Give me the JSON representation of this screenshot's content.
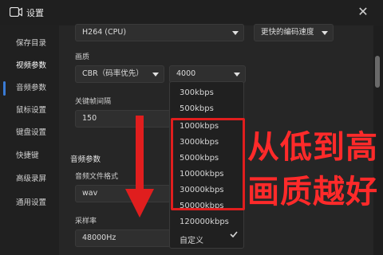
{
  "window": {
    "title": "设置",
    "close_symbol": "✕"
  },
  "sidebar": {
    "items": [
      {
        "label": "保存目录"
      },
      {
        "label": "视频参数"
      },
      {
        "label": "音频参数"
      },
      {
        "label": "鼠标设置"
      },
      {
        "label": "键盘设置"
      },
      {
        "label": "快捷键"
      },
      {
        "label": "高级录屏"
      },
      {
        "label": "通用设置"
      }
    ],
    "active_item": "视频参数"
  },
  "video": {
    "encoder_value": "H264 (CPU)",
    "speed_value": "更快的编码速度",
    "quality_label": "画质",
    "quality_mode_value": "CBR（码率优先）",
    "bitrate_value": "4000",
    "keyframe_label": "关键帧间隔",
    "keyframe_value": "150"
  },
  "audio": {
    "section_title": "音频参数",
    "format_label": "音频文件格式",
    "format_value": "wav",
    "samplerate_label": "采样率",
    "samplerate_value": "48000Hz"
  },
  "bitrate_dropdown": {
    "options": [
      "300kbps",
      "500kbps",
      "1000kbps",
      "3000kbps",
      "5000kbps",
      "10000kbps",
      "30000kbps",
      "50000kbps",
      "120000kbps",
      "自定义"
    ],
    "checked_option": "自定义"
  },
  "annotation": {
    "line1": "从低到高",
    "line2": "画质越好",
    "color": "#e01e1e"
  },
  "icons": {
    "app": "camera-icon",
    "close": "close-icon",
    "dropdown": "chevron-down-icon",
    "check": "check-icon"
  }
}
